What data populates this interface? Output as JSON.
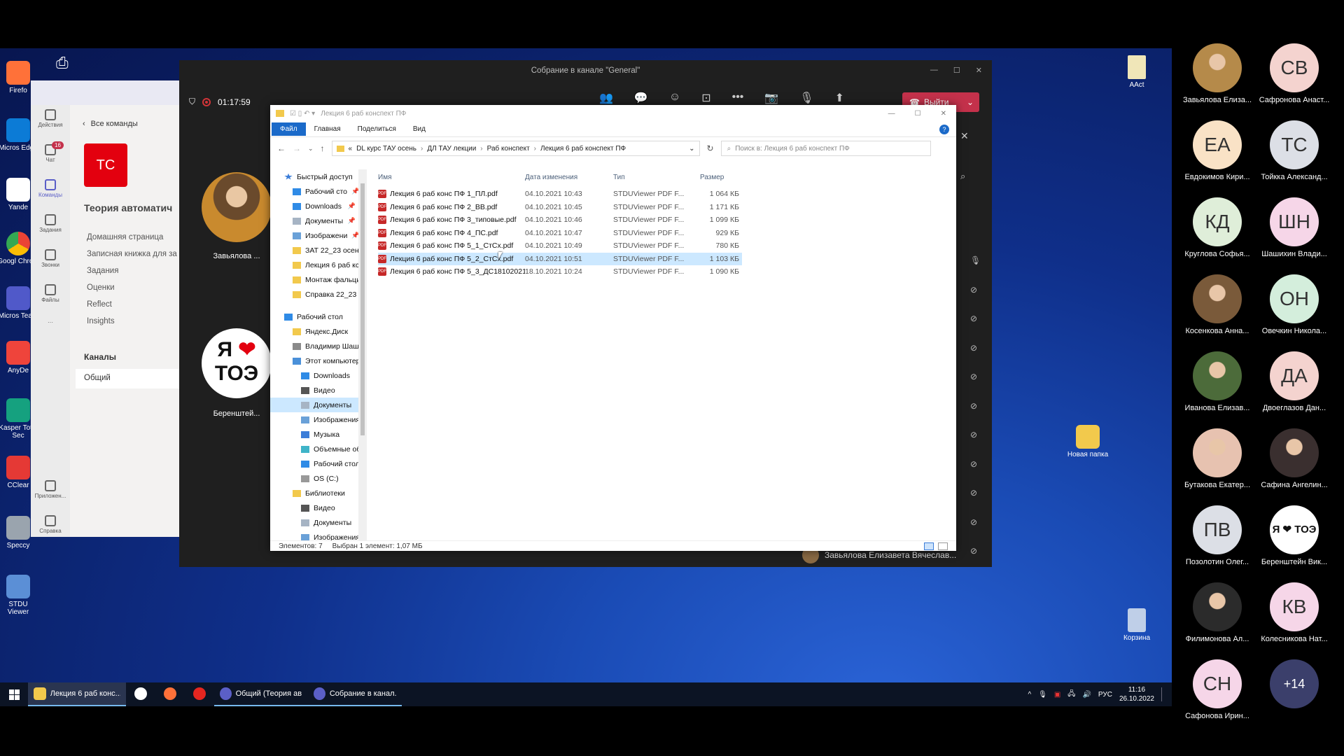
{
  "desktop": {
    "icons": [
      {
        "label": "Firefo",
        "icon": "firefox-icon",
        "color": "#ff7139"
      },
      {
        "label": "Micros Edge",
        "icon": "edge-icon",
        "color": "#0c7bd6"
      },
      {
        "label": "Yande",
        "icon": "yandex-icon",
        "color": "#ffffff"
      },
      {
        "label": "Googl Chrom",
        "icon": "chrome-icon",
        "color": "#2c9f47"
      },
      {
        "label": "Micros Team",
        "icon": "teams-icon",
        "color": "#5059c9"
      },
      {
        "label": "AnyDe",
        "icon": "anydesk-icon",
        "color": "#ef443b"
      },
      {
        "label": "Kasper Total Sec",
        "icon": "kaspersky-icon",
        "color": "#15a17f"
      },
      {
        "label": "CClear",
        "icon": "ccleaner-icon",
        "color": "#e53935"
      },
      {
        "label": "Speccy",
        "icon": "speccy-icon",
        "color": "#9aa4ae"
      },
      {
        "label": "STDU Viewer",
        "icon": "stdu-viewer-icon",
        "color": "#5b8fd6"
      }
    ],
    "right_icons": [
      {
        "label": "AAct",
        "icon": "file-icon"
      },
      {
        "label": "Новая папка",
        "icon": "folder-icon"
      },
      {
        "label": "Корзина",
        "icon": "recycle-bin-icon"
      }
    ]
  },
  "teams": {
    "rail": [
      {
        "label": "Действия",
        "icon": "bell-icon"
      },
      {
        "label": "Чат",
        "icon": "chat-icon",
        "badge": "16"
      },
      {
        "label": "Команды",
        "icon": "teams-group-icon"
      },
      {
        "label": "Задания",
        "icon": "assignments-icon"
      },
      {
        "label": "Звонки",
        "icon": "phone-icon"
      },
      {
        "label": "Файлы",
        "icon": "file-icon"
      },
      {
        "label": "...",
        "icon": "more-icon"
      },
      {
        "label": "Приложен...",
        "icon": "apps-icon"
      },
      {
        "label": "Справка",
        "icon": "help-icon"
      }
    ],
    "back_label": "Все команды",
    "team_avatar": "TC",
    "team_name": "Теория автоматич",
    "nav": [
      "Домашняя страница",
      "Записная книжка для за",
      "Задания",
      "Оценки",
      "Reflect",
      "Insights"
    ],
    "channels_label": "Каналы",
    "channel_selected": "Общий"
  },
  "meeting": {
    "title": "Собрание в канале \"General\"",
    "timer": "01:17:59",
    "leave_label": "Выйти",
    "speaker_name": "Завьялова Елизавета Вячеслав...",
    "video_tiles": [
      {
        "name": "Завьялова ..."
      },
      {
        "name": "Беренштей..."
      }
    ]
  },
  "explorer": {
    "title": "Лекция 6 раб конспект ПФ",
    "ribbon_tabs": [
      "Файл",
      "Главная",
      "Поделиться",
      "Вид"
    ],
    "breadcrumb": [
      "DL курс ТАУ осень",
      "ДЛ ТАУ лекции",
      "Раб конспект",
      "Лекция 6 раб конспект ПФ"
    ],
    "search_placeholder": "Поиск в: Лекция 6 раб конспект ПФ",
    "columns": [
      "Имя",
      "Дата изменения",
      "Тип",
      "Размер"
    ],
    "nav": [
      {
        "label": "Быстрый доступ",
        "icon": "star-icon",
        "level": 0
      },
      {
        "label": "Рабочий сто",
        "icon": "desktop-folder-icon",
        "level": 1,
        "pin": true
      },
      {
        "label": "Downloads",
        "icon": "download-icon",
        "level": 1,
        "pin": true
      },
      {
        "label": "Документы",
        "icon": "documents-icon",
        "level": 1,
        "pin": true
      },
      {
        "label": "Изображени",
        "icon": "pictures-icon",
        "level": 1,
        "pin": true
      },
      {
        "label": "ЗАТ 22_23 осени",
        "icon": "folder-icon",
        "level": 1
      },
      {
        "label": "Лекция 6 раб кс",
        "icon": "folder-icon",
        "level": 1
      },
      {
        "label": "Монтаж фальцы",
        "icon": "folder-icon",
        "level": 1
      },
      {
        "label": "Справка 22_23",
        "icon": "folder-icon",
        "level": 1
      },
      {
        "label": "",
        "icon": "",
        "level": -1
      },
      {
        "label": "Рабочий стол",
        "icon": "desktop-folder-icon",
        "level": 0
      },
      {
        "label": "Яндекс.Диск",
        "icon": "yandex-disk-icon",
        "level": 1
      },
      {
        "label": "Владимир Шаш",
        "icon": "user-icon",
        "level": 1
      },
      {
        "label": "Этот компьютер",
        "icon": "computer-icon",
        "level": 1
      },
      {
        "label": "Downloads",
        "icon": "download-icon",
        "level": 2
      },
      {
        "label": "Видео",
        "icon": "video-icon",
        "level": 2
      },
      {
        "label": "Документы",
        "icon": "documents-icon",
        "level": 2,
        "selected": true
      },
      {
        "label": "Изображения",
        "icon": "pictures-icon",
        "level": 2
      },
      {
        "label": "Музыка",
        "icon": "music-icon",
        "level": 2
      },
      {
        "label": "Объемные об",
        "icon": "3d-objects-icon",
        "level": 2
      },
      {
        "label": "Рабочий стол",
        "icon": "desktop-folder-icon",
        "level": 2
      },
      {
        "label": "OS (C:)",
        "icon": "drive-icon",
        "level": 2
      },
      {
        "label": "Библиотеки",
        "icon": "folder-icon",
        "level": 1
      },
      {
        "label": "Видео",
        "icon": "video-icon",
        "level": 2
      },
      {
        "label": "Документы",
        "icon": "documents-icon",
        "level": 2
      },
      {
        "label": "Изображения",
        "icon": "pictures-icon",
        "level": 2
      }
    ],
    "files": [
      {
        "name": "Лекция 6 раб конс ПФ 1_ПЛ.pdf",
        "date": "04.10.2021 10:43",
        "type": "STDUViewer PDF F...",
        "size": "1 064 КБ"
      },
      {
        "name": "Лекция 6 раб конс ПФ 2_ВВ.pdf",
        "date": "04.10.2021 10:45",
        "type": "STDUViewer PDF F...",
        "size": "1 171 КБ"
      },
      {
        "name": "Лекция 6 раб конс ПФ 3_типовые.pdf",
        "date": "04.10.2021 10:46",
        "type": "STDUViewer PDF F...",
        "size": "1 099 КБ"
      },
      {
        "name": "Лекция 6 раб конс ПФ 4_ПС.pdf",
        "date": "04.10.2021 10:47",
        "type": "STDUViewer PDF F...",
        "size": "929 КБ"
      },
      {
        "name": "Лекция 6 раб конс ПФ 5_1_СтСх.pdf",
        "date": "04.10.2021 10:49",
        "type": "STDUViewer PDF F...",
        "size": "780 КБ"
      },
      {
        "name": "Лекция 6 раб конс ПФ 5_2_СтСх.pdf",
        "date": "04.10.2021 10:51",
        "type": "STDUViewer PDF F...",
        "size": "1 103 КБ",
        "selected": true
      },
      {
        "name": "Лекция 6 раб конс ПФ 5_3_ДС18102021....",
        "date": "18.10.2021 10:24",
        "type": "STDUViewer PDF F...",
        "size": "1 090 КБ"
      }
    ],
    "status_count": "Элементов: 7",
    "status_selected": "Выбран 1 элемент: 1,07 МБ"
  },
  "taskbar": {
    "items": [
      {
        "label": "Лекция 6 раб конс...",
        "icon": "folder-icon",
        "active": true
      },
      {
        "label": "",
        "icon": "yandex-browser-icon"
      },
      {
        "label": "",
        "icon": "firefox-icon"
      },
      {
        "label": "",
        "icon": "yandex-icon"
      },
      {
        "label": "Общий (Теория ав...",
        "icon": "teams-icon"
      },
      {
        "label": "Собрание в канал...",
        "icon": "teams-icon"
      }
    ],
    "lang": "РУС",
    "time": "11:16",
    "date": "26.10.2022"
  },
  "participants": [
    {
      "name": "Завьялова Елиза...",
      "initials": "",
      "photo": true,
      "color": "#b58a4a"
    },
    {
      "name": "Сафронова Анаст...",
      "initials": "СВ",
      "color": "#f4d3cf"
    },
    {
      "name": "Евдокимов Кири...",
      "initials": "ЕА",
      "color": "#f9e2c6"
    },
    {
      "name": "Тойкка Александ...",
      "initials": "TC",
      "color": "#dcdfe6"
    },
    {
      "name": "Круглова Софья...",
      "initials": "КД",
      "color": "#dfeed9"
    },
    {
      "name": "Шашихин Влади...",
      "initials": "ШН",
      "color": "#f6d6e8"
    },
    {
      "name": "Косенкова Анна...",
      "initials": "",
      "photo": true,
      "color": "#7a5a3a"
    },
    {
      "name": "Овечкин Никола...",
      "initials": "ОН",
      "color": "#d4eedc"
    },
    {
      "name": "Иванова Елизав...",
      "initials": "",
      "photo": true,
      "color": "#4c6b3a"
    },
    {
      "name": "Двоеглазов Дан...",
      "initials": "ДА",
      "color": "#f4d3cf"
    },
    {
      "name": "Бутакова Екатер...",
      "initials": "",
      "photo": true,
      "color": "#e7c2b0"
    },
    {
      "name": "Сафина Ангелин...",
      "initials": "",
      "photo": true,
      "color": "#3a2f2f"
    },
    {
      "name": "Позолотин Олег...",
      "initials": "ПВ",
      "color": "#dcdfe6"
    },
    {
      "name": "Беренштейн Вик...",
      "initials": "Я ❤ ТОЭ",
      "color": "#ffffff"
    },
    {
      "name": "Филимонова Ал...",
      "initials": "",
      "photo": true,
      "color": "#2b2b2b"
    },
    {
      "name": "Колесникова Нат...",
      "initials": "КВ",
      "color": "#f6d6e8"
    },
    {
      "name": "Сафонова Ирин...",
      "initials": "СН",
      "color": "#f6d6e8"
    },
    {
      "name": "",
      "initials": "+14",
      "color": "#3b3f6b"
    }
  ]
}
